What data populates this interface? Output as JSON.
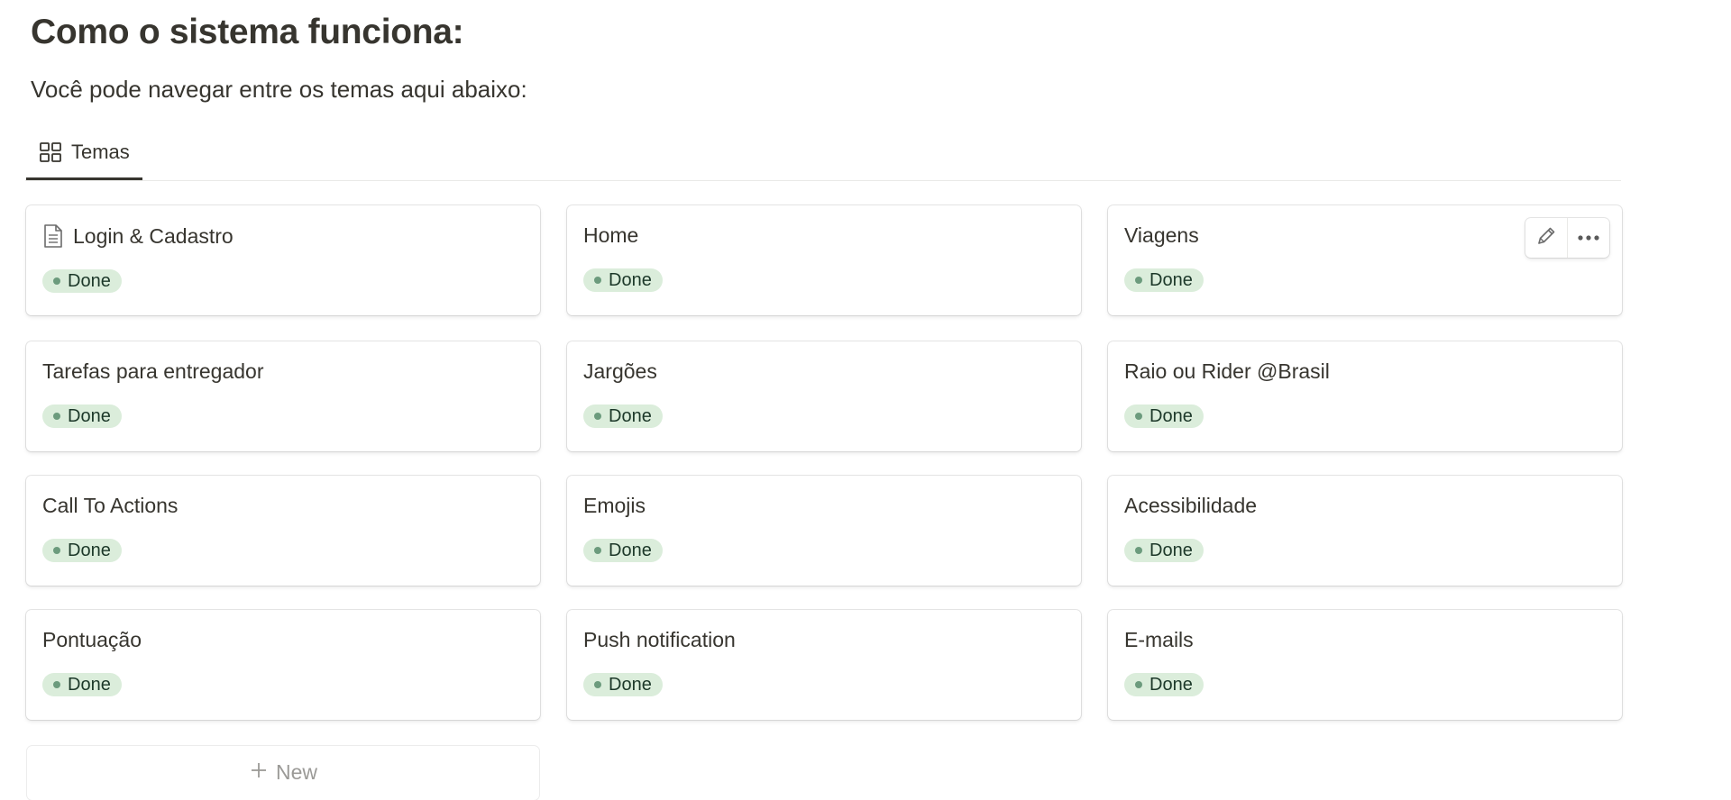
{
  "page": {
    "title": "Como o sistema funciona:",
    "subtitle": "Você pode navegar entre os temas aqui abaixo:"
  },
  "view_tabs": [
    {
      "label": "Temas",
      "icon": "gallery-view-icon",
      "active": true
    }
  ],
  "cards": [
    {
      "title": "Login & Cadastro",
      "status": "Done",
      "has_page_icon": true
    },
    {
      "title": "Home",
      "status": "Done"
    },
    {
      "title": "Viagens",
      "status": "Done",
      "hover_actions": [
        "edit-icon",
        "more-icon"
      ]
    },
    {
      "title": "Tarefas para entregador",
      "status": "Done"
    },
    {
      "title": "Jargões",
      "status": "Done"
    },
    {
      "title": "Raio ou Rider @Brasil",
      "status": "Done"
    },
    {
      "title": "Call To Actions",
      "status": "Done"
    },
    {
      "title": "Emojis",
      "status": "Done"
    },
    {
      "title": "Acessibilidade",
      "status": "Done"
    },
    {
      "title": "Pontuação",
      "status": "Done"
    },
    {
      "title": "Push notification",
      "status": "Done"
    },
    {
      "title": "E-mails",
      "status": "Done"
    }
  ],
  "new_card": {
    "label": "New",
    "icon": "plus-icon"
  },
  "colors": {
    "text": "#37352f",
    "status_bg": "#dbeddb",
    "status_dot": "#6c9b7d",
    "status_text": "#1c3829",
    "muted": "#9b9a97"
  }
}
